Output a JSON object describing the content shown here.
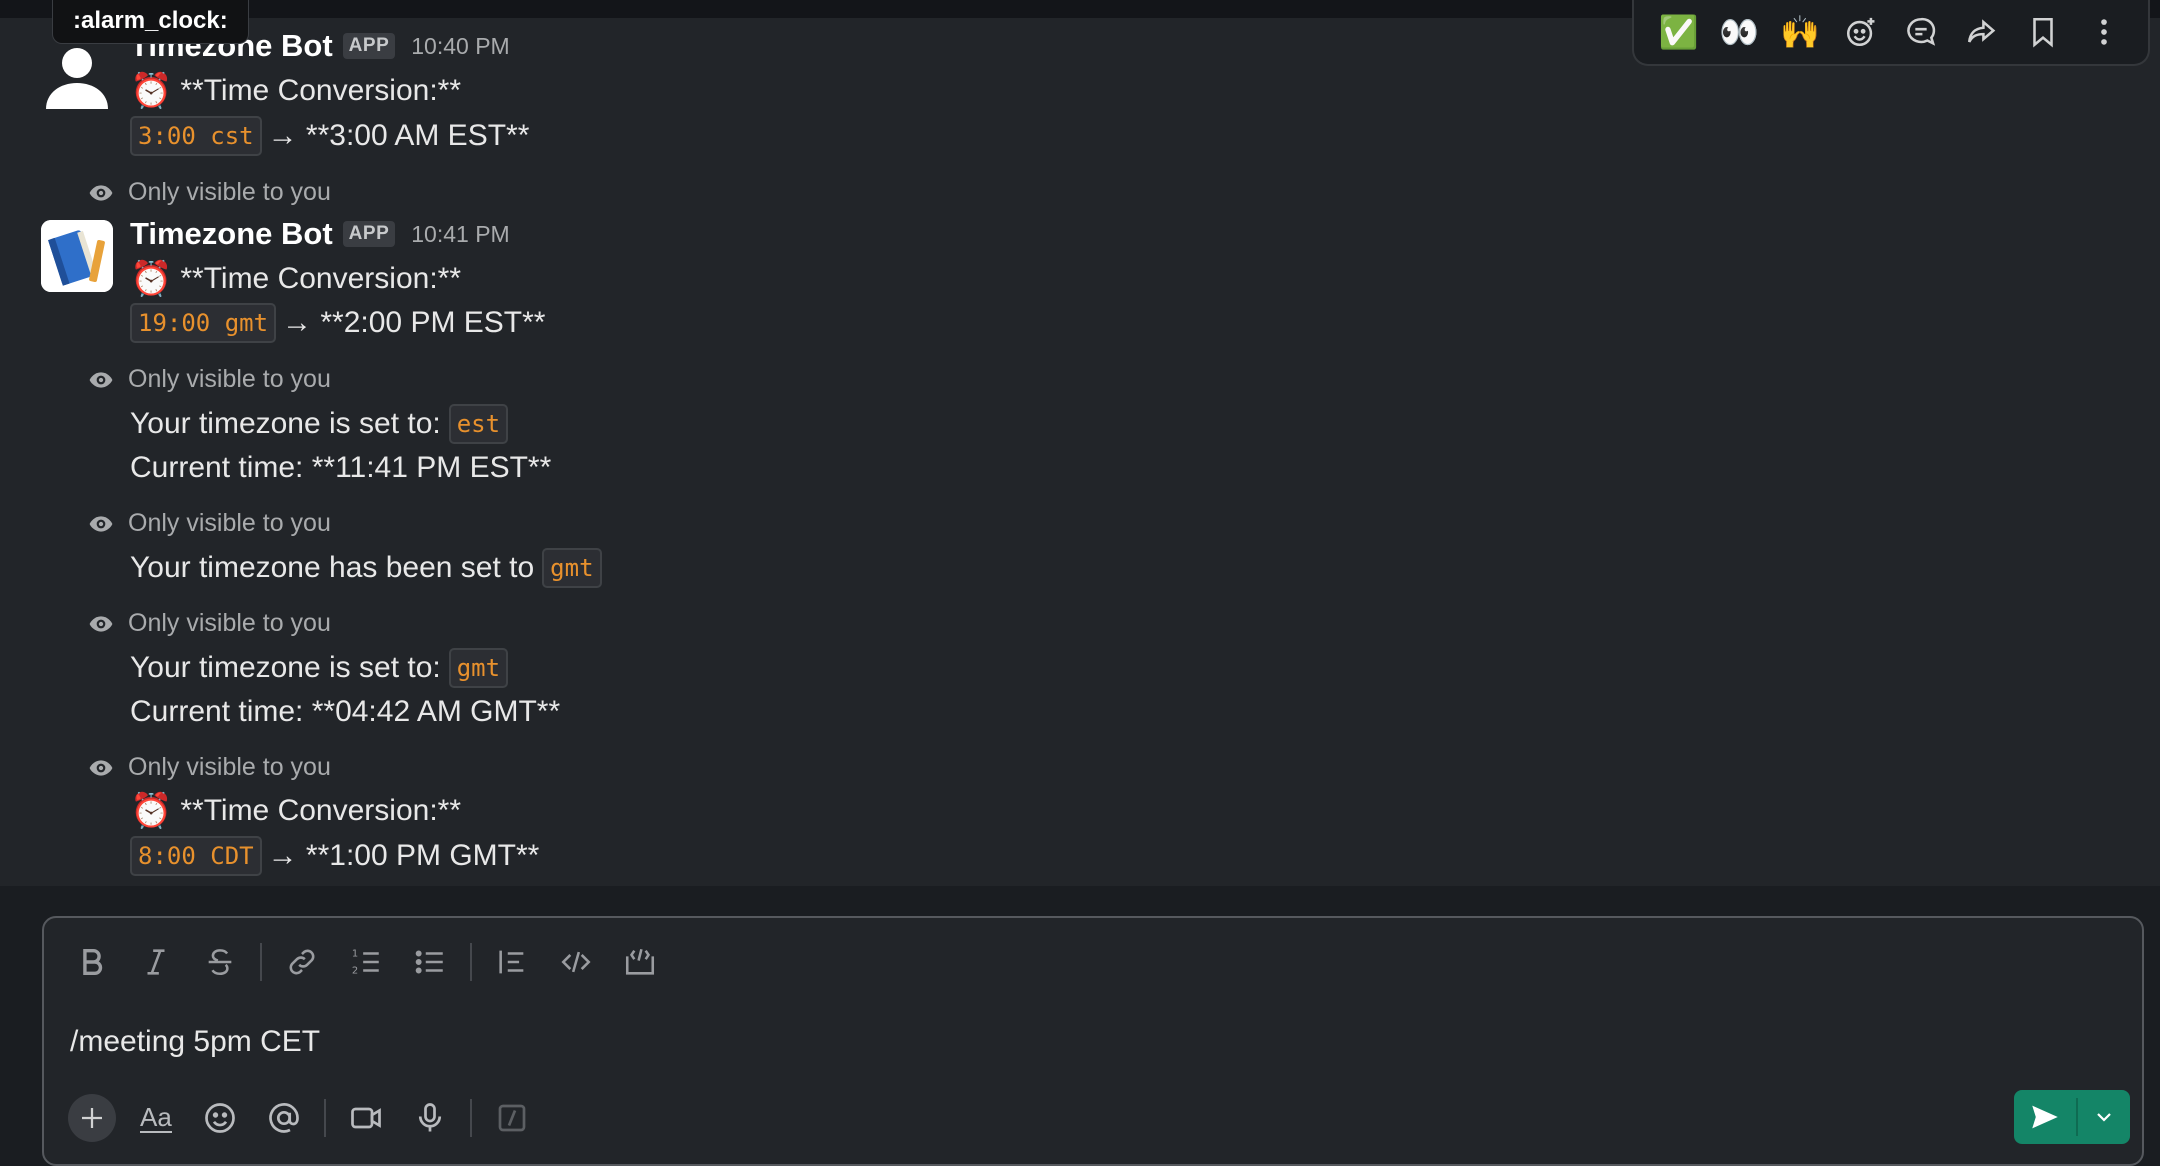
{
  "tooltip": {
    "text": ":alarm_clock:"
  },
  "hover_actions": [
    {
      "name": "react-check-button",
      "glyph": "✅"
    },
    {
      "name": "react-eyes-button",
      "glyph": "👀"
    },
    {
      "name": "react-raised-hands-button",
      "glyph": "🙌"
    }
  ],
  "messages": [
    {
      "sender": "Timezone Bot",
      "badge": "APP",
      "time": "10:40 PM",
      "emoji": "⏰",
      "title": "**Time Conversion:**",
      "code": "3:00 cst",
      "result": "→ **3:00 AM EST**"
    },
    {
      "visibility": "Only visible to you",
      "sender": "Timezone Bot",
      "badge": "APP",
      "time": "10:41 PM",
      "emoji": "⏰",
      "title": "**Time Conversion:**",
      "code": "19:00 gmt",
      "result": "→ **2:00 PM EST**"
    },
    {
      "visibility": "Only visible to you",
      "line1_prefix": "Your timezone is set to:",
      "line1_code": "est",
      "line2": "Current time: **11:41 PM EST**"
    },
    {
      "visibility": "Only visible to you",
      "line1_prefix": "Your timezone has been set to",
      "line1_code": "gmt"
    },
    {
      "visibility": "Only visible to you",
      "line1_prefix": "Your timezone is set to:",
      "line1_code": "gmt",
      "line2": "Current time: **04:42 AM GMT**"
    },
    {
      "visibility": "Only visible to you",
      "emoji": "⏰",
      "title": "**Time Conversion:**",
      "code": "8:00 CDT",
      "result": "→ **1:00 PM GMT**"
    }
  ],
  "composer": {
    "value": "/meeting 5pm CET",
    "placeholder": ""
  },
  "colors": {
    "send": "#148567",
    "code_text": "#e8912d"
  }
}
